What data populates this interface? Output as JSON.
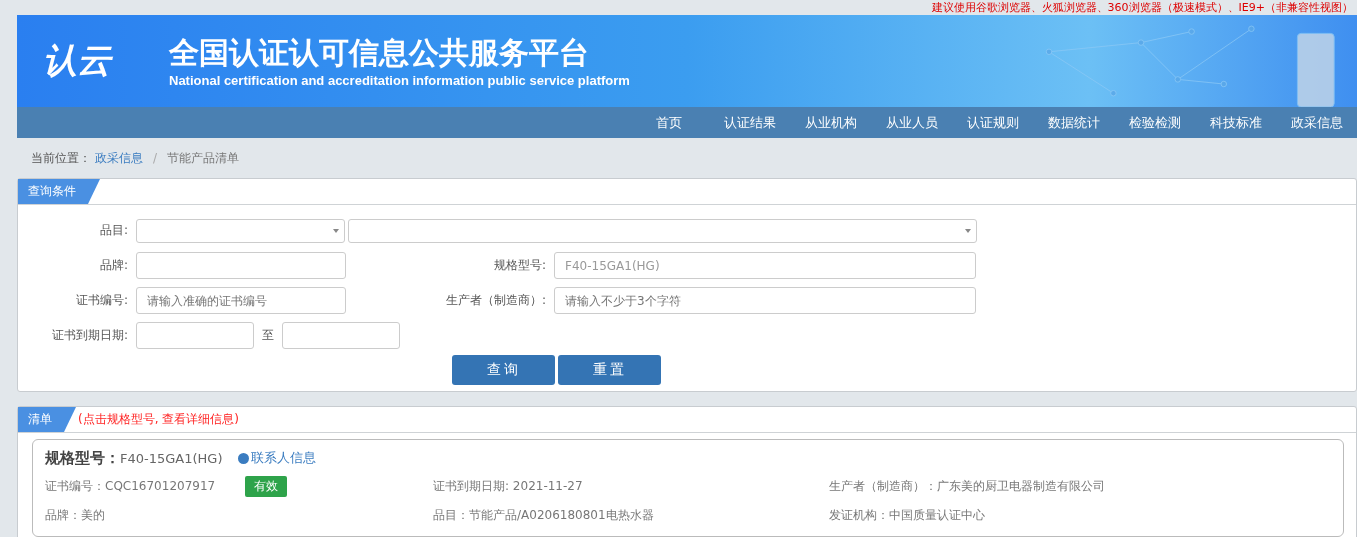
{
  "notice": "建议使用谷歌浏览器、火狐浏览器、360浏览器（极速模式）、IE9+（非兼容性视图）",
  "header": {
    "logo_text": "认云",
    "title": "全国认证认可信息公共服务平台",
    "subtitle": "National certification and accreditation information public service platform"
  },
  "nav": [
    {
      "label": "首页",
      "selected": false
    },
    {
      "label": "认证结果",
      "selected": false
    },
    {
      "label": "从业机构",
      "selected": false
    },
    {
      "label": "从业人员",
      "selected": false
    },
    {
      "label": "认证规则",
      "selected": false
    },
    {
      "label": "数据统计",
      "selected": false
    },
    {
      "label": "检验检测",
      "selected": false
    },
    {
      "label": "科技标准",
      "selected": false
    },
    {
      "label": "政采信息",
      "selected": false
    }
  ],
  "breadcrumb": {
    "label": "当前位置：",
    "link": "政采信息",
    "separator": "/",
    "current": "节能产品清单"
  },
  "query": {
    "title": "查询条件",
    "category_label": "品目:",
    "brand_label": "品牌:",
    "model_label": "规格型号:",
    "model_value": "F40-15GA1(HG)",
    "cert_label": "证书编号:",
    "cert_placeholder": "请输入准确的证书编号",
    "maker_label": "生产者（制造商）:",
    "maker_placeholder": "请输入不少于3个字符",
    "expiry_label": "证书到期日期:",
    "to": "至",
    "buttons": [
      "查询",
      "重置"
    ]
  },
  "list": {
    "title": "清单",
    "hint": "(点击规格型号, 查看详细信息)",
    "items": [
      {
        "model_label": "规格型号：",
        "model": "F40-15GA1(HG)",
        "contact": "联系人信息",
        "cert_label": "证书编号：",
        "cert": "CQC16701207917",
        "status": "有效",
        "expiry_label": "证书到期日期:",
        "expiry": "2021-11-27",
        "maker_label": "生产者（制造商）：",
        "maker": "广东美的厨卫电器制造有限公司",
        "brand_label": "品牌：",
        "brand": "美的",
        "category_label": "品目：",
        "category": "节能产品/A0206180801电热水器",
        "issuer_label": "发证机构：",
        "issuer": "中国质量认证中心"
      }
    ]
  }
}
